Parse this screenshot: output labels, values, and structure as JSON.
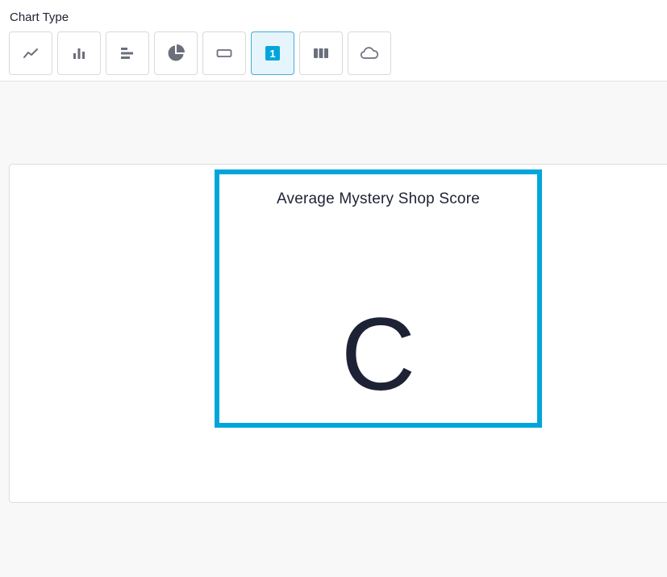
{
  "header": {
    "section_label": "Chart Type"
  },
  "chart_types": [
    {
      "icon": "line-chart-icon",
      "selected": false
    },
    {
      "icon": "bar-chart-icon",
      "selected": false
    },
    {
      "icon": "horizontal-bar-chart-icon",
      "selected": false
    },
    {
      "icon": "pie-chart-icon",
      "selected": false
    },
    {
      "icon": "rectangle-icon",
      "selected": false
    },
    {
      "icon": "single-value-icon",
      "selected": true,
      "glyph": "1"
    },
    {
      "icon": "columns-icon",
      "selected": false
    },
    {
      "icon": "cloud-icon",
      "selected": false
    }
  ],
  "widget": {
    "title": "Average Mystery Shop Score",
    "value": "C"
  },
  "colors": {
    "accent": "#00a6db",
    "icon": "#6b6f7b",
    "text": "#1e2235",
    "selected_bg": "#e6f5fc"
  }
}
